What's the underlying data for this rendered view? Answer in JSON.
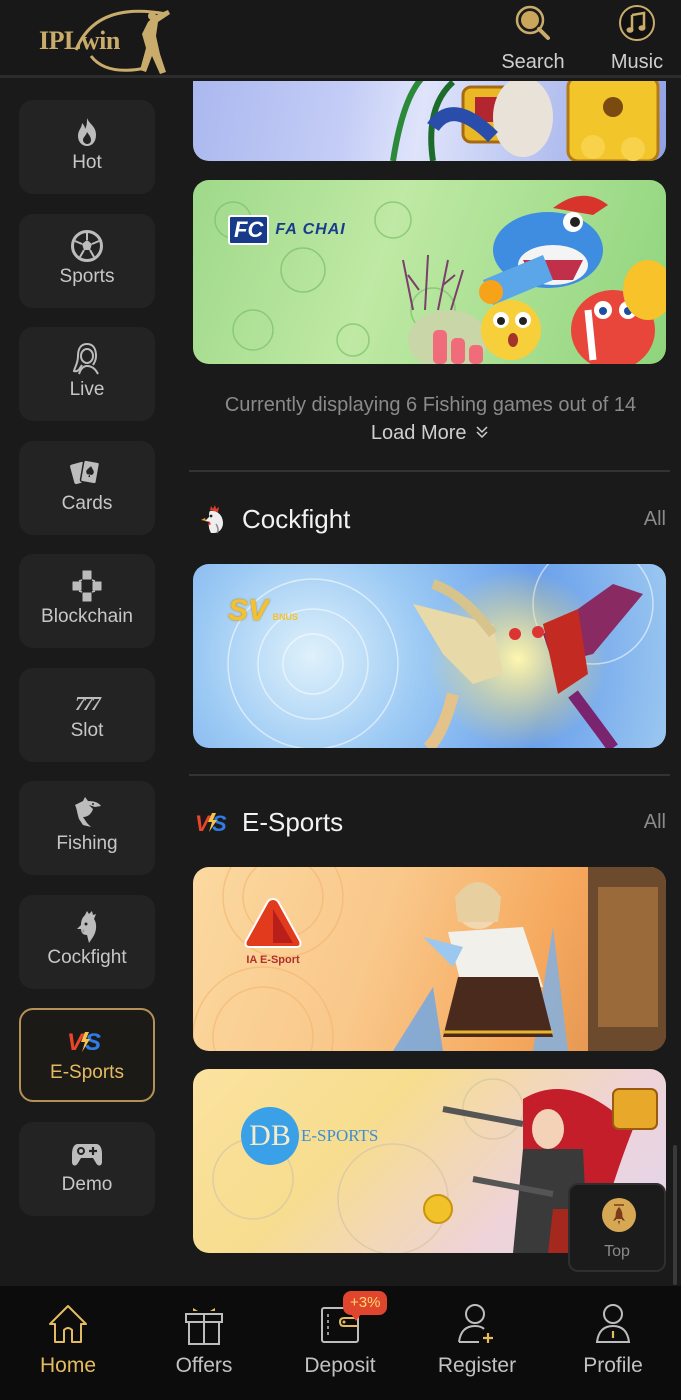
{
  "header": {
    "logo_text": "IPLwin",
    "search_label": "Search",
    "music_label": "Music"
  },
  "sidebar": {
    "items": [
      {
        "label": "Hot",
        "icon": "fire-icon",
        "active": false
      },
      {
        "label": "Sports",
        "icon": "soccer-ball-icon",
        "active": false
      },
      {
        "label": "Live",
        "icon": "live-dealer-icon",
        "active": false
      },
      {
        "label": "Cards",
        "icon": "playing-cards-icon",
        "active": false
      },
      {
        "label": "Blockchain",
        "icon": "blockchain-icon",
        "active": false
      },
      {
        "label": "Slot",
        "icon": "slot-777-icon",
        "active": false
      },
      {
        "label": "Fishing",
        "icon": "shark-icon",
        "active": false
      },
      {
        "label": "Cockfight",
        "icon": "rooster-icon",
        "active": false
      },
      {
        "label": "E-Sports",
        "icon": "vs-icon",
        "active": true
      },
      {
        "label": "Demo",
        "icon": "gamepad-icon",
        "active": false
      }
    ]
  },
  "fishing": {
    "banners": [
      {
        "provider": "",
        "theme": "treasure"
      },
      {
        "provider": "FA CHAI",
        "logo_mark": "FC"
      }
    ],
    "info_text": "Currently displaying 6 Fishing games out of 14",
    "load_more_label": "Load More",
    "load_more_icon": "double-chevron-down-icon"
  },
  "cockfight": {
    "title": "Cockfight",
    "all_label": "All",
    "banners": [
      {
        "provider": "SV",
        "sub": "BNUS"
      }
    ]
  },
  "esports": {
    "title": "E-Sports",
    "all_label": "All",
    "banners": [
      {
        "provider": "IA E-Sport"
      },
      {
        "provider": "E-SPORTS",
        "logo_mark": "DB"
      }
    ]
  },
  "top_button": {
    "label": "Top"
  },
  "bottom_nav": {
    "items": [
      {
        "label": "Home",
        "icon": "home-icon",
        "active": true
      },
      {
        "label": "Offers",
        "icon": "gift-icon",
        "active": false
      },
      {
        "label": "Deposit",
        "icon": "wallet-icon",
        "active": false,
        "badge": "+3%"
      },
      {
        "label": "Register",
        "icon": "add-user-icon",
        "active": false
      },
      {
        "label": "Profile",
        "icon": "profile-icon",
        "active": false
      }
    ]
  },
  "colors": {
    "accent_gold": "#e5bb60",
    "background": "#1a1a1a",
    "badge_red": "#e0452e"
  }
}
